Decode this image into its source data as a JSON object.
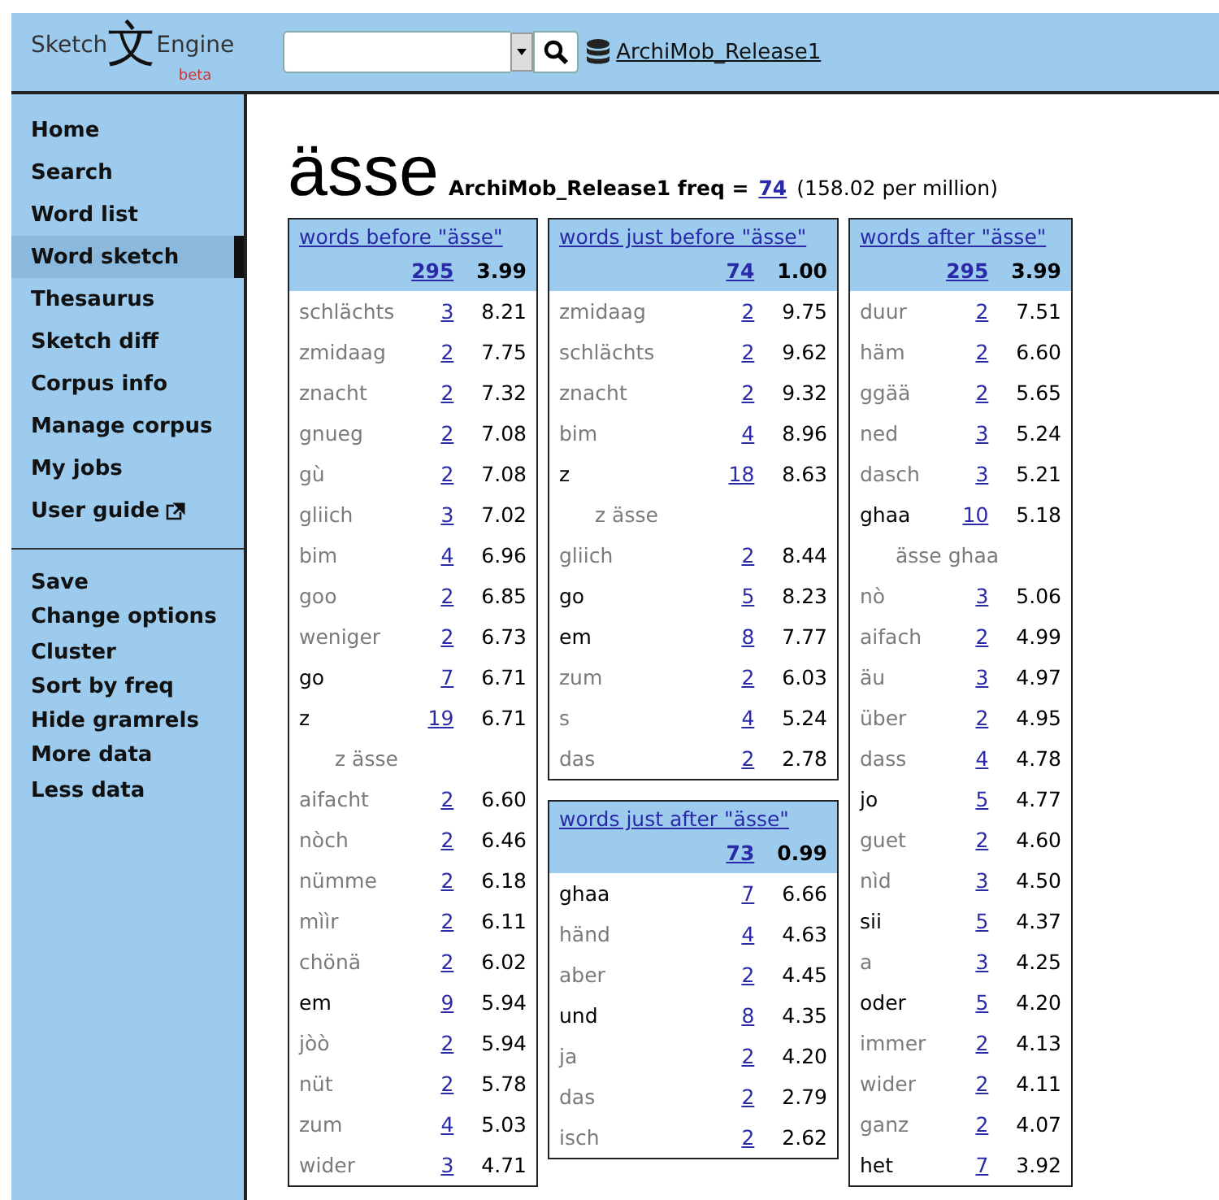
{
  "logo": {
    "left": "Sketch",
    "glyph": "文",
    "right": "Engine",
    "badge": "beta"
  },
  "corpus_link": "ArchiMob_Release1",
  "nav": [
    {
      "label": "Home",
      "selected": false,
      "external": false
    },
    {
      "label": "Search",
      "selected": false,
      "external": false
    },
    {
      "label": "Word list",
      "selected": false,
      "external": false
    },
    {
      "label": "Word sketch",
      "selected": true,
      "external": false
    },
    {
      "label": "Thesaurus",
      "selected": false,
      "external": false
    },
    {
      "label": "Sketch diff",
      "selected": false,
      "external": false
    },
    {
      "label": "Corpus info",
      "selected": false,
      "external": false
    },
    {
      "label": "Manage corpus",
      "selected": false,
      "external": false
    },
    {
      "label": "My jobs",
      "selected": false,
      "external": false
    },
    {
      "label": "User guide",
      "selected": false,
      "external": true
    }
  ],
  "actions": [
    "Save",
    "Change options",
    "Cluster",
    "Sort by freq",
    "Hide gramrels",
    "More data",
    "Less data"
  ],
  "heading": {
    "word": "ässe",
    "corpus_freq": "ArchiMob_Release1 freq =",
    "freq": "74",
    "per_million": "(158.02 per million)"
  },
  "columns": [
    [
      {
        "title": "words before \"ässe\"",
        "total": "295",
        "score": "3.99",
        "rows": [
          {
            "kind": "word",
            "word": "schlächts",
            "count": "3",
            "score": "8.21",
            "dark": false
          },
          {
            "kind": "word",
            "word": "zmidaag",
            "count": "2",
            "score": "7.75",
            "dark": false
          },
          {
            "kind": "word",
            "word": "znacht",
            "count": "2",
            "score": "7.32",
            "dark": false
          },
          {
            "kind": "word",
            "word": "gnueg",
            "count": "2",
            "score": "7.08",
            "dark": false
          },
          {
            "kind": "word",
            "word": "gù",
            "count": "2",
            "score": "7.08",
            "dark": false
          },
          {
            "kind": "word",
            "word": "gliich",
            "count": "3",
            "score": "7.02",
            "dark": false
          },
          {
            "kind": "word",
            "word": "bim",
            "count": "4",
            "score": "6.96",
            "dark": false
          },
          {
            "kind": "word",
            "word": "goo",
            "count": "2",
            "score": "6.85",
            "dark": false
          },
          {
            "kind": "word",
            "word": "weniger",
            "count": "2",
            "score": "6.73",
            "dark": false
          },
          {
            "kind": "word",
            "word": "go",
            "count": "7",
            "score": "6.71",
            "dark": true
          },
          {
            "kind": "word",
            "word": "z",
            "count": "19",
            "score": "6.71",
            "dark": true
          },
          {
            "kind": "cluster",
            "word": "z ässe"
          },
          {
            "kind": "word",
            "word": "aifacht",
            "count": "2",
            "score": "6.60",
            "dark": false
          },
          {
            "kind": "word",
            "word": "nòch",
            "count": "2",
            "score": "6.46",
            "dark": false
          },
          {
            "kind": "word",
            "word": "nümme",
            "count": "2",
            "score": "6.18",
            "dark": false
          },
          {
            "kind": "word",
            "word": "mììr",
            "count": "2",
            "score": "6.11",
            "dark": false
          },
          {
            "kind": "word",
            "word": "chönä",
            "count": "2",
            "score": "6.02",
            "dark": false
          },
          {
            "kind": "word",
            "word": "em",
            "count": "9",
            "score": "5.94",
            "dark": true
          },
          {
            "kind": "word",
            "word": "jòò",
            "count": "2",
            "score": "5.94",
            "dark": false
          },
          {
            "kind": "word",
            "word": "nüt",
            "count": "2",
            "score": "5.78",
            "dark": false
          },
          {
            "kind": "word",
            "word": "zum",
            "count": "4",
            "score": "5.03",
            "dark": false
          },
          {
            "kind": "word",
            "word": "wider",
            "count": "3",
            "score": "4.71",
            "dark": false
          }
        ]
      }
    ],
    [
      {
        "title": "words just before \"ässe\"",
        "total": "74",
        "score": "1.00",
        "rows": [
          {
            "kind": "word",
            "word": "zmidaag",
            "count": "2",
            "score": "9.75",
            "dark": false
          },
          {
            "kind": "word",
            "word": "schlächts",
            "count": "2",
            "score": "9.62",
            "dark": false
          },
          {
            "kind": "word",
            "word": "znacht",
            "count": "2",
            "score": "9.32",
            "dark": false
          },
          {
            "kind": "word",
            "word": "bim",
            "count": "4",
            "score": "8.96",
            "dark": false
          },
          {
            "kind": "word",
            "word": "z",
            "count": "18",
            "score": "8.63",
            "dark": true
          },
          {
            "kind": "cluster",
            "word": "z ässe"
          },
          {
            "kind": "word",
            "word": "gliich",
            "count": "2",
            "score": "8.44",
            "dark": false
          },
          {
            "kind": "word",
            "word": "go",
            "count": "5",
            "score": "8.23",
            "dark": true
          },
          {
            "kind": "word",
            "word": "em",
            "count": "8",
            "score": "7.77",
            "dark": true
          },
          {
            "kind": "word",
            "word": "zum",
            "count": "2",
            "score": "6.03",
            "dark": false
          },
          {
            "kind": "word",
            "word": "s",
            "count": "4",
            "score": "5.24",
            "dark": false
          },
          {
            "kind": "word",
            "word": "das",
            "count": "2",
            "score": "2.78",
            "dark": false
          }
        ]
      },
      {
        "title": "words just after \"ässe\"",
        "total": "73",
        "score": "0.99",
        "rows": [
          {
            "kind": "word",
            "word": "ghaa",
            "count": "7",
            "score": "6.66",
            "dark": true
          },
          {
            "kind": "word",
            "word": "händ",
            "count": "4",
            "score": "4.63",
            "dark": false
          },
          {
            "kind": "word",
            "word": "aber",
            "count": "2",
            "score": "4.45",
            "dark": false
          },
          {
            "kind": "word",
            "word": "und",
            "count": "8",
            "score": "4.35",
            "dark": true
          },
          {
            "kind": "word",
            "word": "ja",
            "count": "2",
            "score": "4.20",
            "dark": false
          },
          {
            "kind": "word",
            "word": "das",
            "count": "2",
            "score": "2.79",
            "dark": false
          },
          {
            "kind": "word",
            "word": "isch",
            "count": "2",
            "score": "2.62",
            "dark": false
          }
        ]
      }
    ],
    [
      {
        "title": "words after \"ässe\"",
        "total": "295",
        "score": "3.99",
        "rows": [
          {
            "kind": "word",
            "word": "duur",
            "count": "2",
            "score": "7.51",
            "dark": false
          },
          {
            "kind": "word",
            "word": "häm",
            "count": "2",
            "score": "6.60",
            "dark": false
          },
          {
            "kind": "word",
            "word": "ggää",
            "count": "2",
            "score": "5.65",
            "dark": false
          },
          {
            "kind": "word",
            "word": "ned",
            "count": "3",
            "score": "5.24",
            "dark": false
          },
          {
            "kind": "word",
            "word": "dasch",
            "count": "3",
            "score": "5.21",
            "dark": false
          },
          {
            "kind": "word",
            "word": "ghaa",
            "count": "10",
            "score": "5.18",
            "dark": true
          },
          {
            "kind": "cluster",
            "word": "ässe ghaa"
          },
          {
            "kind": "word",
            "word": "nò",
            "count": "3",
            "score": "5.06",
            "dark": false
          },
          {
            "kind": "word",
            "word": "aifach",
            "count": "2",
            "score": "4.99",
            "dark": false
          },
          {
            "kind": "word",
            "word": "äu",
            "count": "3",
            "score": "4.97",
            "dark": false
          },
          {
            "kind": "word",
            "word": "über",
            "count": "2",
            "score": "4.95",
            "dark": false
          },
          {
            "kind": "word",
            "word": "dass",
            "count": "4",
            "score": "4.78",
            "dark": false
          },
          {
            "kind": "word",
            "word": "jo",
            "count": "5",
            "score": "4.77",
            "dark": true
          },
          {
            "kind": "word",
            "word": "guet",
            "count": "2",
            "score": "4.60",
            "dark": false
          },
          {
            "kind": "word",
            "word": "nìd",
            "count": "3",
            "score": "4.50",
            "dark": false
          },
          {
            "kind": "word",
            "word": "sii",
            "count": "5",
            "score": "4.37",
            "dark": true
          },
          {
            "kind": "word",
            "word": "a",
            "count": "3",
            "score": "4.25",
            "dark": false
          },
          {
            "kind": "word",
            "word": "oder",
            "count": "5",
            "score": "4.20",
            "dark": true
          },
          {
            "kind": "word",
            "word": "immer",
            "count": "2",
            "score": "4.13",
            "dark": false
          },
          {
            "kind": "word",
            "word": "wider",
            "count": "2",
            "score": "4.11",
            "dark": false
          },
          {
            "kind": "word",
            "word": "ganz",
            "count": "2",
            "score": "4.07",
            "dark": false
          },
          {
            "kind": "word",
            "word": "het",
            "count": "7",
            "score": "3.92",
            "dark": true
          }
        ]
      }
    ]
  ]
}
